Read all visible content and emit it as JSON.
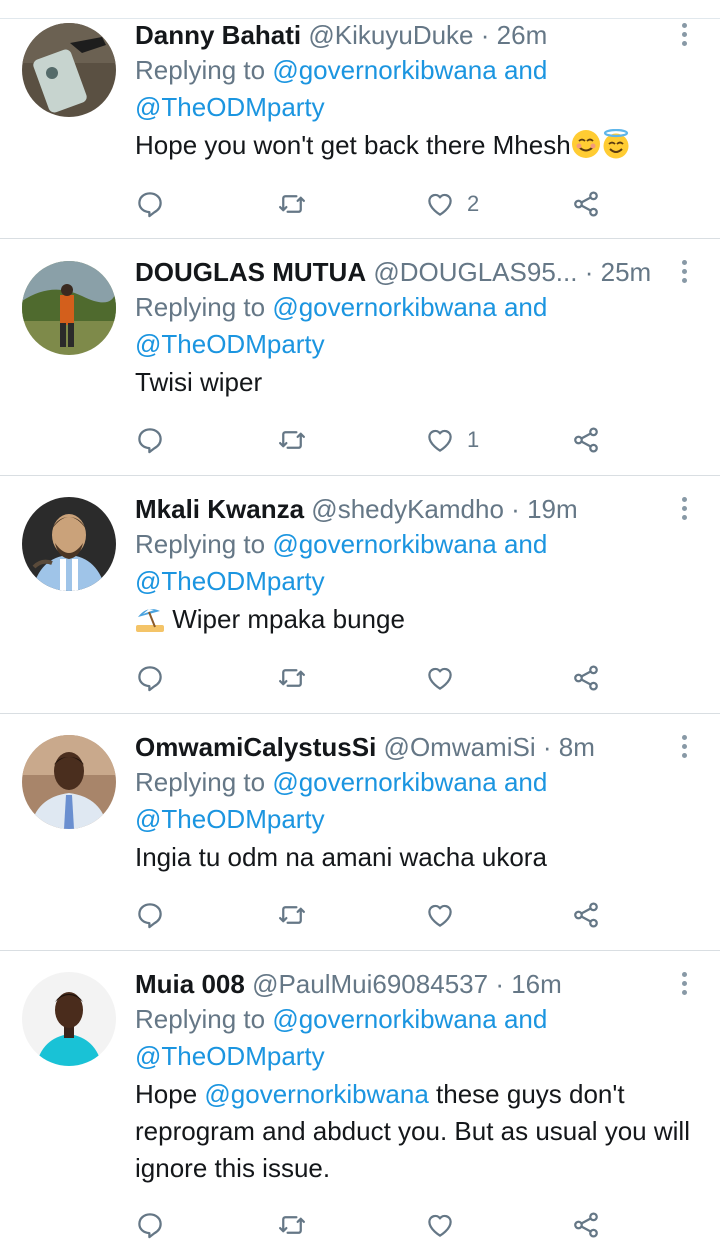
{
  "tweets": [
    {
      "name": "Danny Bahati",
      "handle": "@KikuyuDuke",
      "sep": "·",
      "time": "26m",
      "replying_prefix": "Replying to",
      "replying_to": [
        "@governorkibwana",
        "@TheODMparty"
      ],
      "replying_joiner": "and",
      "text": "Hope you won't get back there Mhesh",
      "text_emojis": [
        "smiling-face-emoji",
        "halo-face-emoji"
      ],
      "like_count": "2"
    },
    {
      "name": "DOUGLAS MUTUA",
      "handle": "@DOUGLAS95...",
      "sep": "·",
      "time": "25m",
      "replying_prefix": "Replying to",
      "replying_to": [
        "@governorkibwana",
        "@TheODMparty"
      ],
      "replying_joiner": "and",
      "text": "Twisi wiper",
      "like_count": "1"
    },
    {
      "name": "Mkali Kwanza",
      "handle": "@shedyKamdho",
      "sep": "·",
      "time": "19m",
      "replying_prefix": "Replying to",
      "replying_to": [
        "@governorkibwana",
        "@TheODMparty"
      ],
      "replying_joiner": "and",
      "leading_emoji": "beach-umbrella-emoji",
      "text": "Wiper mpaka bunge",
      "like_count": ""
    },
    {
      "name": "OmwamiCalystusSi",
      "handle": "@OmwamiSi",
      "sep": "·",
      "time": "8m",
      "replying_prefix": "Replying to",
      "replying_to": [
        "@governorkibwana",
        "@TheODMparty"
      ],
      "replying_joiner": "and",
      "text": "Ingia tu odm na amani wacha ukora",
      "like_count": ""
    },
    {
      "name": "Muia 008",
      "handle": "@PaulMui69084537",
      "sep": "·",
      "time": "16m",
      "replying_prefix": "Replying to",
      "replying_to": [
        "@governorkibwana",
        "@TheODMparty"
      ],
      "replying_joiner": "and",
      "text_before": "Hope",
      "text_mention": "@governorkibwana",
      "text_after": "these guys don't reprogram and abduct you. But as usual you will ignore this issue.",
      "like_count": ""
    }
  ],
  "icons": {
    "reply": "reply-icon",
    "retweet": "retweet-icon",
    "like": "heart-icon",
    "share": "share-icon",
    "more": "more-options-icon"
  },
  "colors": {
    "link": "#1b95e0",
    "secondary_text": "#657786",
    "primary_text": "#14171a",
    "divider": "#d9dee2"
  }
}
